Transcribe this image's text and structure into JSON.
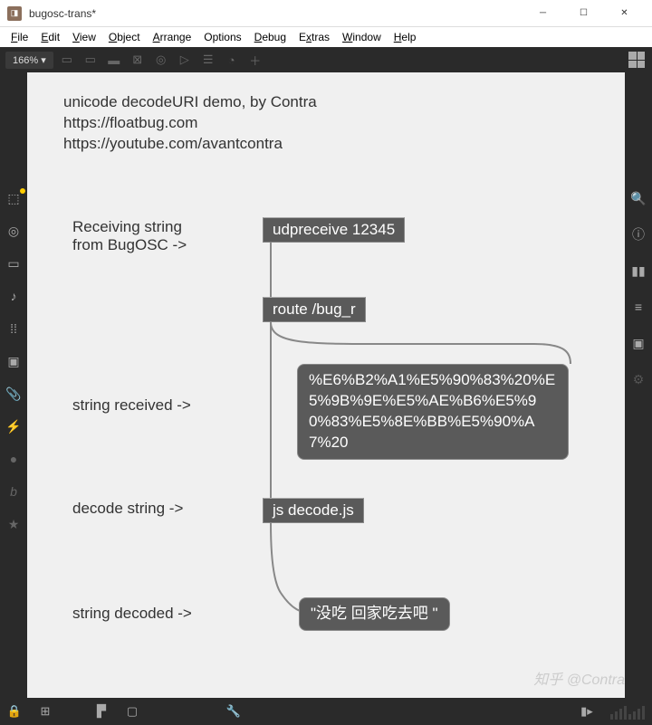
{
  "window": {
    "title": "bugosc-trans*"
  },
  "menu": {
    "file": "File",
    "edit": "Edit",
    "view": "View",
    "object": "Object",
    "arrange": "Arrange",
    "options": "Options",
    "debug": "Debug",
    "extras": "Extras",
    "window_": "Window",
    "help": "Help"
  },
  "topbar": {
    "zoom": "166% ▾"
  },
  "canvas": {
    "comment_l1": "unicode decodeURI demo, by Contra",
    "comment_l2": "https://floatbug.com",
    "comment_l3": "https://youtube.com/avantcontra",
    "lbl_recv_l1": "Receiving string",
    "lbl_recv_l2": "from BugOSC ->",
    "lbl_received": "string received ->",
    "lbl_decode": "decode string ->",
    "lbl_decoded": "string decoded ->",
    "obj_udp": "udpreceive 12345",
    "obj_route": "route /bug_r",
    "obj_js": "js decode.js",
    "msg_encoded": "%E6%B2%A1%E5%90%83%20%E5%9B%9E%E5%AE%B6%E5%90%83%E5%8E%BB%E5%90%A7%20",
    "msg_decoded": "\"没吃 回家吃去吧 \""
  },
  "watermark": "知乎 @Contra"
}
